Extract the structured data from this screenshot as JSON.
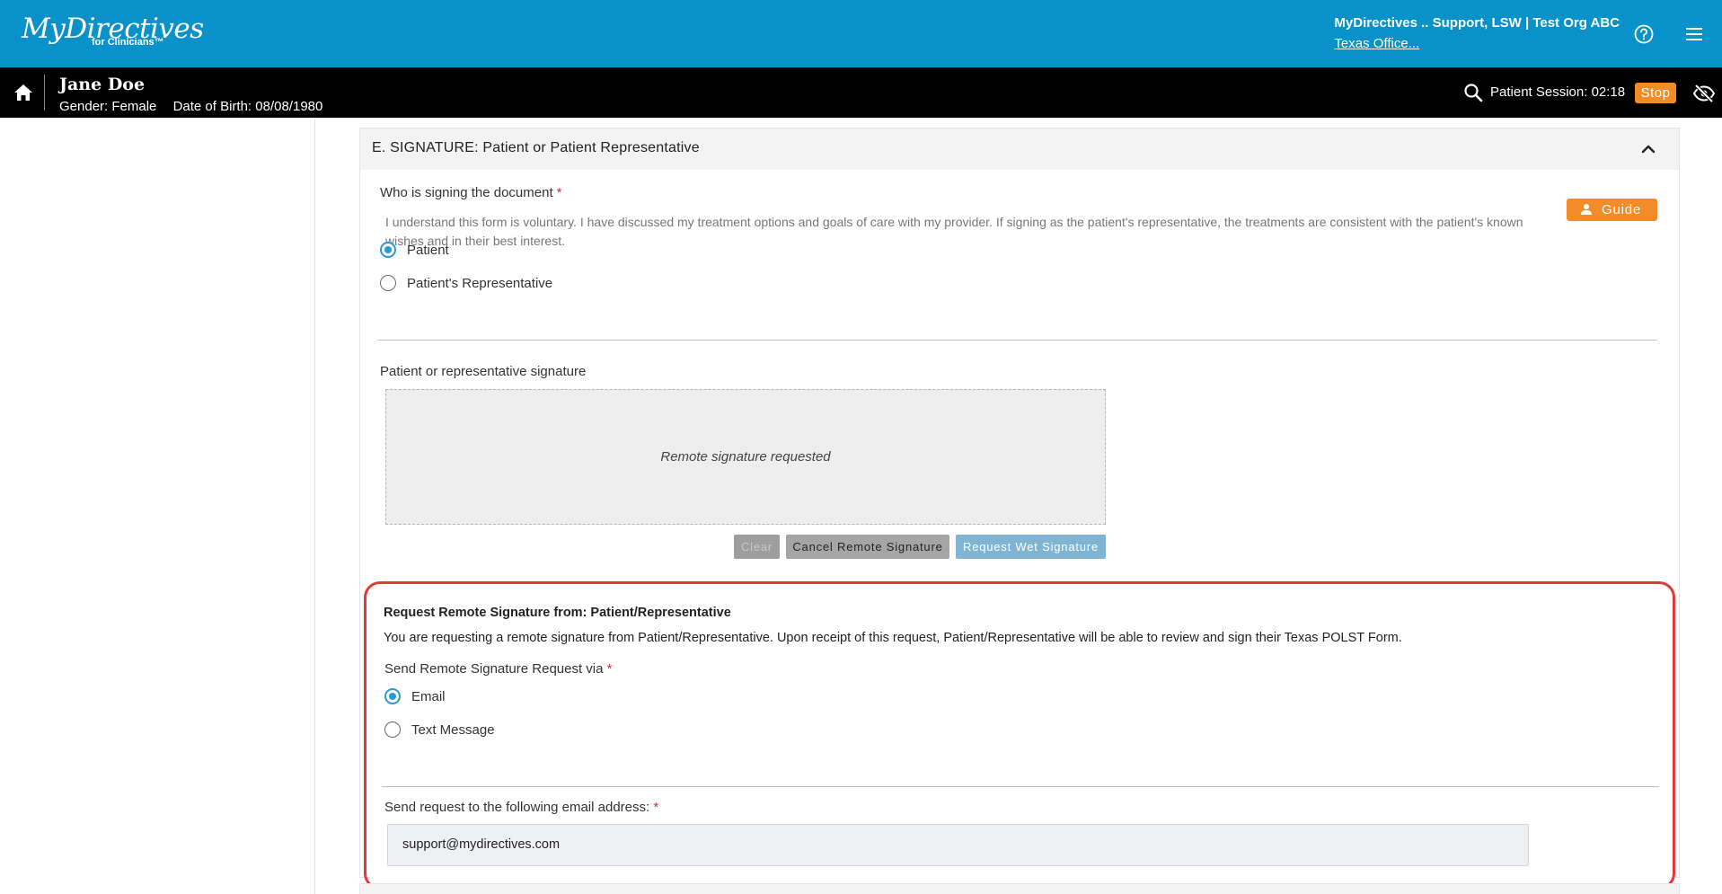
{
  "header": {
    "logo_text": "MyDirectives",
    "logo_sub": "for Clinicians™",
    "user_name": "MyDirectives .. Support, LSW | Test Org ABC",
    "office_link": "Texas Office...",
    "icons": [
      "help-icon",
      "hamburger-menu-icon"
    ]
  },
  "patient_bar": {
    "name": "Jane Doe",
    "gender": "Gender: Female",
    "dob": "Date of Birth: 08/08/1980",
    "session": "Patient Session: 02:18",
    "stop_label": "Stop",
    "icons": [
      "home-icon",
      "search-icon",
      "eye-off-icon"
    ]
  },
  "section": {
    "title": "E. SIGNATURE: Patient or Patient Representative",
    "guide_label": "Guide",
    "signer_question": "Who is signing the document",
    "required_mark": "*",
    "signer_description": "I understand this form is voluntary. I have discussed my treatment options and goals of care with my provider. If signing as the patient's representative, the treatments are consistent with the patient's known wishes and in their best interest.",
    "signer_options": [
      {
        "label": "Patient",
        "checked": true
      },
      {
        "label": "Patient's Representative",
        "checked": false
      }
    ],
    "signature_label": "Patient or representative signature",
    "signature_status": "Remote signature requested",
    "buttons": {
      "clear": "Clear",
      "cancel_remote": "Cancel Remote Signature",
      "request_wet": "Request Wet Signature"
    }
  },
  "remote_request": {
    "title": "Request Remote Signature from: Patient/Representative",
    "description": "You are requesting a remote signature from Patient/Representative. Upon receipt of this request, Patient/Representative will be able to review and sign their Texas POLST Form.",
    "via_label": "Send Remote Signature Request via",
    "via_options": [
      {
        "label": "Email",
        "checked": true
      },
      {
        "label": "Text Message",
        "checked": false
      }
    ],
    "email_label": "Send request to the following email address:",
    "email_value": "support@mydirectives.com"
  },
  "colors": {
    "header_blue": "#0991c9",
    "accent_orange": "#f28c28",
    "radio_blue": "#2a9ad6",
    "highlight_red": "#e53935"
  }
}
